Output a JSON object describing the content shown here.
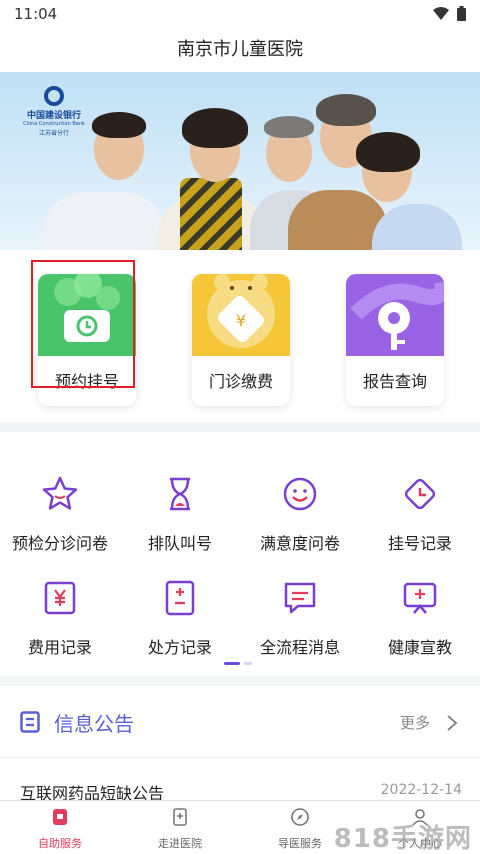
{
  "status_bar": {
    "time": "11:04"
  },
  "header": {
    "title": "南京市儿童医院"
  },
  "banner": {
    "bank_name": "中国建设银行",
    "bank_name_en": "China Construction Bank",
    "bank_branch": "江苏省分行"
  },
  "quick_actions": [
    {
      "label": "预约挂号",
      "color": "#49c46a"
    },
    {
      "label": "门诊缴费",
      "color": "#f5c738"
    },
    {
      "label": "报告查询",
      "color": "#9a63e6"
    }
  ],
  "menu": {
    "items": [
      {
        "label": "预检分诊问卷",
        "icon": "star-icon"
      },
      {
        "label": "排队叫号",
        "icon": "hourglass-icon"
      },
      {
        "label": "满意度问卷",
        "icon": "smiley-icon"
      },
      {
        "label": "挂号记录",
        "icon": "clock-diamond-icon"
      },
      {
        "label": "费用记录",
        "icon": "yen-receipt-icon"
      },
      {
        "label": "处方记录",
        "icon": "prescription-icon"
      },
      {
        "label": "全流程消息",
        "icon": "message-icon"
      },
      {
        "label": "健康宣教",
        "icon": "monitor-plus-icon"
      }
    ],
    "accent_color": "#7a3fd0"
  },
  "notice": {
    "title": "信息公告",
    "more": "更多",
    "items": [
      {
        "title": "互联网药品短缺公告",
        "date": "2022-12-14"
      }
    ]
  },
  "tabbar": {
    "tabs": [
      {
        "label": "自助服务",
        "active": true
      },
      {
        "label": "走进医院",
        "active": false
      },
      {
        "label": "导医服务",
        "active": false
      },
      {
        "label": "个人中心",
        "active": false
      }
    ],
    "active_color": "#e23b5c"
  },
  "watermark": "818手游网"
}
